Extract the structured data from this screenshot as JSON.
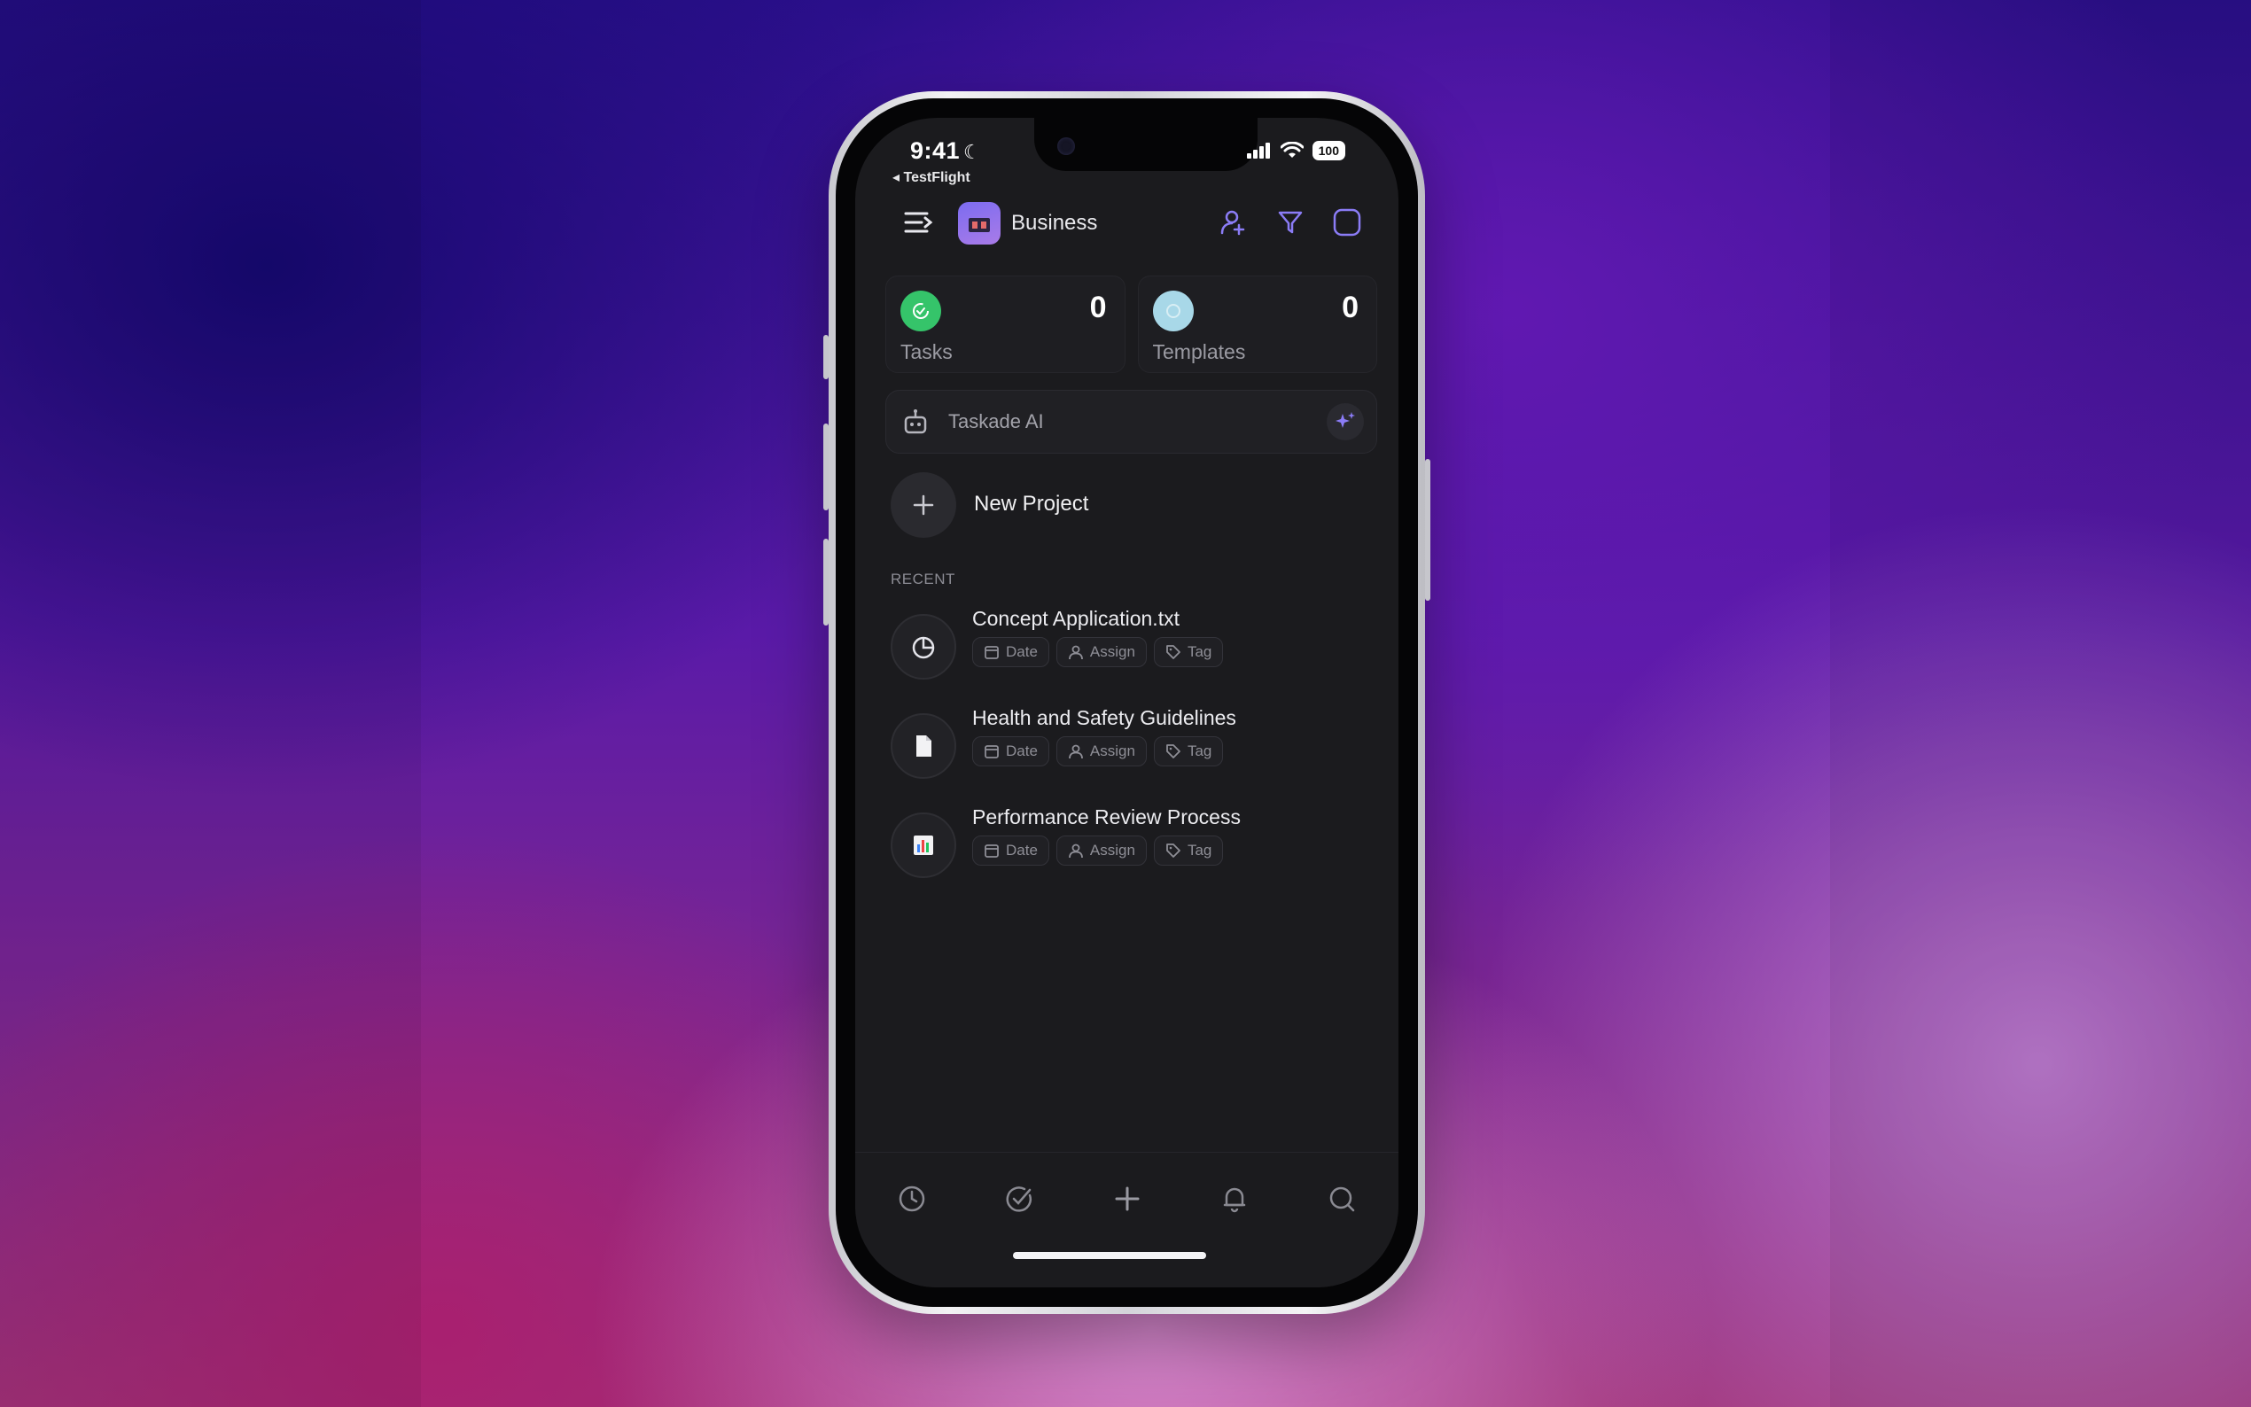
{
  "status_bar": {
    "time": "9:41",
    "back_app": "◂ TestFlight",
    "battery": "100"
  },
  "header": {
    "workspace_name": "Business",
    "icons": [
      "menu-icon",
      "add-user-icon",
      "filter-icon",
      "square-icon"
    ]
  },
  "stats": [
    {
      "label": "Tasks",
      "count": "0",
      "icon": "check-circle-icon",
      "color": "#35c46a"
    },
    {
      "label": "Templates",
      "count": "0",
      "icon": "template-icon",
      "color": "#a8d8e8"
    }
  ],
  "ai": {
    "placeholder": "Taskade AI"
  },
  "new_project": {
    "label": "New Project"
  },
  "recent": {
    "heading": "RECENT",
    "items": [
      {
        "title": "Concept Application.txt",
        "icon": "pie-chart-icon"
      },
      {
        "title": "Health and Safety Guidelines",
        "icon": "document-icon"
      },
      {
        "title": "Performance Review Process",
        "icon": "bar-chart-icon"
      }
    ],
    "chip_labels": {
      "date": "Date",
      "assign": "Assign",
      "tag": "Tag"
    }
  },
  "tabbar": {
    "items": [
      "history-icon",
      "check-icon",
      "plus-icon",
      "bell-icon",
      "search-icon"
    ]
  },
  "colors": {
    "accent": "#8b7cf6",
    "screen_bg": "#1b1b1e"
  }
}
